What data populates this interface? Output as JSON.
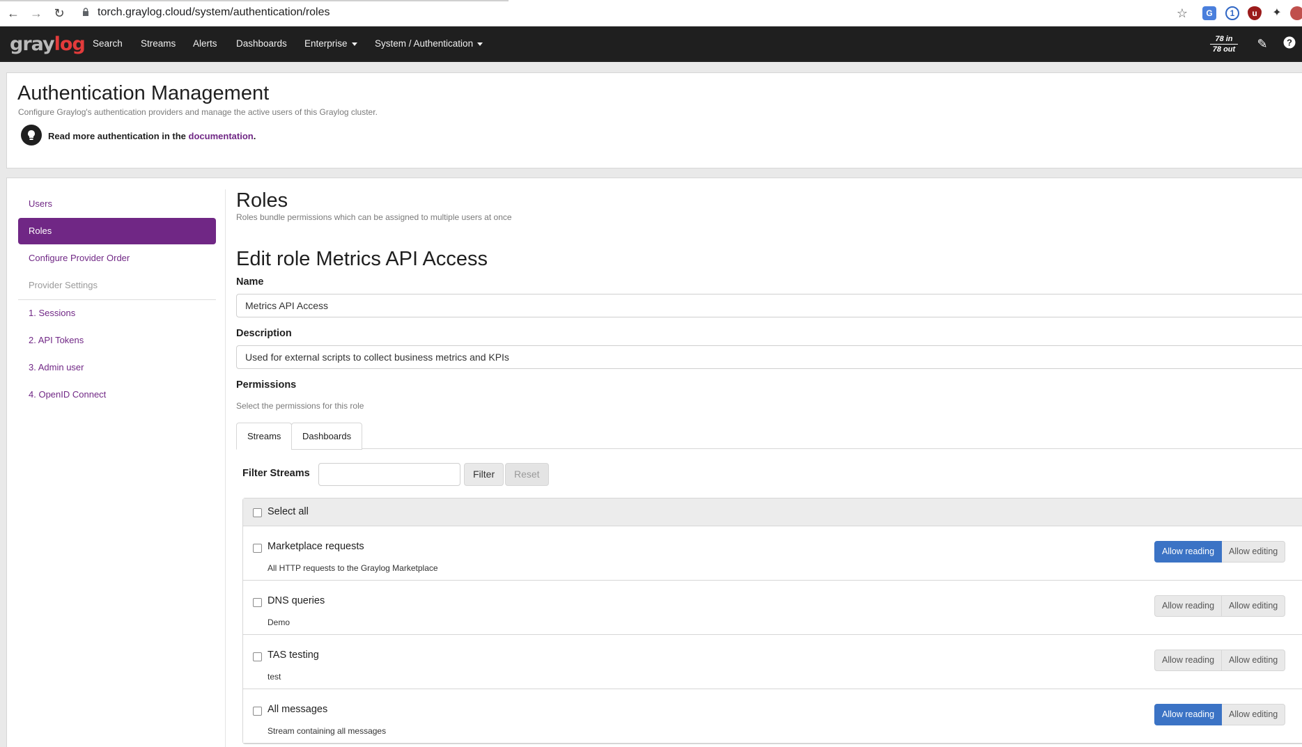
{
  "browser": {
    "url_host": "torch.graylog.cloud",
    "url_path": "/system/authentication/roles"
  },
  "nav": {
    "logo": "graylog",
    "items": [
      "Search",
      "Streams",
      "Alerts",
      "Dashboards",
      "Enterprise",
      "System / Authentication"
    ],
    "throughput_in": "78 in",
    "throughput_out": "78 out"
  },
  "header": {
    "title": "Authentication Management",
    "subtitle": "Configure Graylog's authentication providers and manage the active users of this Graylog cluster.",
    "doc_prefix": "Read more authentication in the ",
    "doc_link": "documentation",
    "doc_suffix": "."
  },
  "sidebar": {
    "items": [
      "Users",
      "Roles",
      "Configure Provider Order",
      "Provider Settings"
    ],
    "providers": [
      "1. Sessions",
      "2. API Tokens",
      "3. Admin user",
      "4. OpenID Connect"
    ]
  },
  "roles": {
    "title": "Roles",
    "subtitle": "Roles bundle permissions which can be assigned to multiple users at once",
    "edit_title": "Edit role Metrics API Access",
    "name_label": "Name",
    "name_value": "Metrics API Access",
    "description_label": "Description",
    "description_value": "Used for external scripts to collect business metrics and KPIs",
    "permissions_label": "Permissions",
    "permissions_sub": "Select the permissions for this role",
    "tabs": [
      "Streams",
      "Dashboards"
    ],
    "filter_label": "Filter Streams",
    "filter_button": "Filter",
    "reset_button": "Reset",
    "select_all": "Select all",
    "allow_reading": "Allow reading",
    "allow_editing": "Allow editing",
    "streams": [
      {
        "title": "Marketplace requests",
        "description": "All HTTP requests to the Graylog Marketplace",
        "reading": true
      },
      {
        "title": "DNS queries",
        "description": "Demo",
        "reading": false
      },
      {
        "title": "TAS testing",
        "description": "test",
        "reading": false
      },
      {
        "title": "All messages",
        "description": "Stream containing all messages",
        "reading": true
      }
    ]
  },
  "colors": {
    "brand_purple": "#702785",
    "navbar": "#1f1f1f",
    "active_blue": "#3b73c5"
  }
}
